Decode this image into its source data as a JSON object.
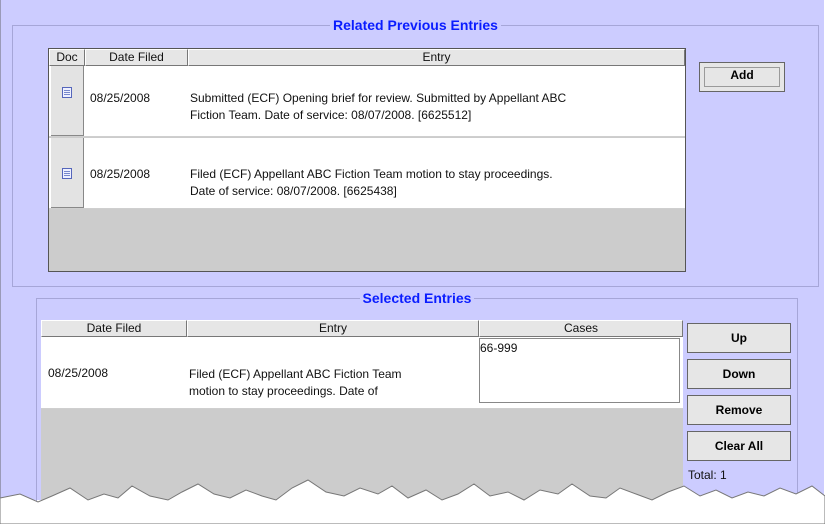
{
  "related": {
    "title": "Related Previous Entries",
    "columns": [
      "Doc",
      "Date Filed",
      "Entry"
    ],
    "rows": [
      {
        "date": "08/25/2008",
        "entry_line1": "Submitted (ECF) Opening brief for review. Submitted by Appellant ABC",
        "entry_line2": "Fiction Team. Date of service: 08/07/2008. [6625512]"
      },
      {
        "date": "08/25/2008",
        "entry_line1": "Filed (ECF) Appellant ABC Fiction Team motion to stay proceedings.",
        "entry_line2": "Date of service: 08/07/2008. [6625438]"
      }
    ],
    "add_label": "Add"
  },
  "selected": {
    "title": "Selected Entries",
    "columns": [
      "Date Filed",
      "Entry",
      "Cases"
    ],
    "rows": [
      {
        "date": "08/25/2008",
        "entry_line1": "Filed (ECF) Appellant ABC Fiction Team",
        "entry_line2": "motion to stay proceedings. Date of",
        "cases": "66-999"
      }
    ],
    "buttons": {
      "up": "Up",
      "down": "Down",
      "remove": "Remove",
      "clear_all": "Clear All"
    },
    "total": "Total: 1"
  },
  "icons": {
    "doc": "document-icon"
  },
  "colors": {
    "panel_bg": "#ccccff",
    "legend": "#0a1dff",
    "table_empty": "#cccccc"
  }
}
